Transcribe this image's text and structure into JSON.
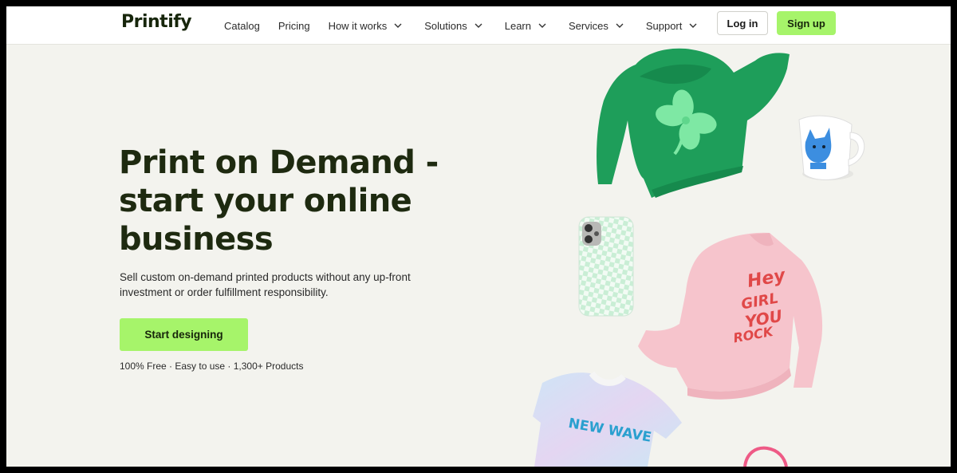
{
  "header": {
    "logo": "Printify",
    "nav": [
      {
        "label": "Catalog",
        "dropdown": false
      },
      {
        "label": "Pricing",
        "dropdown": false
      },
      {
        "label": "How it works",
        "dropdown": true
      },
      {
        "label": "Solutions",
        "dropdown": true
      },
      {
        "label": "Learn",
        "dropdown": true
      },
      {
        "label": "Services",
        "dropdown": true
      },
      {
        "label": "Support",
        "dropdown": true
      }
    ],
    "login_label": "Log in",
    "signup_label": "Sign up"
  },
  "hero": {
    "title_line1": "Print on Demand -",
    "title_line2": "start your online",
    "title_line3": "business",
    "subtitle_line1": "Sell custom on-demand printed products without any up-front",
    "subtitle_line2": "investment or order fulfillment responsibility.",
    "cta_label": "Start designing",
    "features": "100% Free · Easy to use · 1,300+ Products"
  },
  "products": {
    "sweatshirt_print": [
      "Hey",
      "GIRL",
      "YOU",
      "ROCK"
    ],
    "tshirt_print": "NEW WAVE"
  },
  "colors": {
    "brand_green": "#a6f46a",
    "dark_text": "#1e2a10",
    "page_background": "#f3f3ee",
    "hoodie": "#1e9e5a",
    "sweatshirt": "#f6c4cc"
  }
}
